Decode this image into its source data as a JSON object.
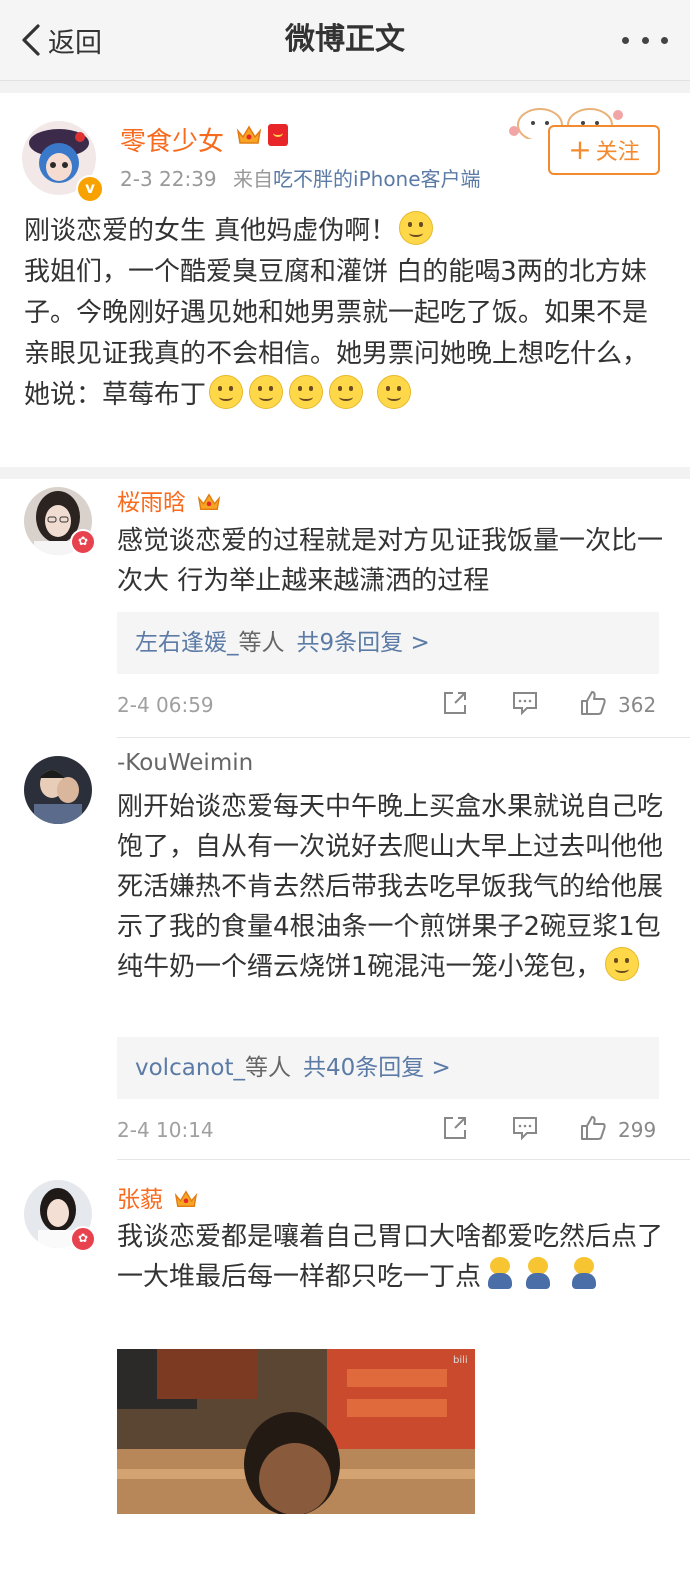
{
  "nav": {
    "back_label": "返回",
    "title": "微博正文"
  },
  "post": {
    "author": "零食少女",
    "time": "2-3 22:39",
    "source_prefix": "来自",
    "source": "吃不胖的iPhone客户端",
    "follow_label": "关注",
    "text_line1": "刚谈恋爱的女生  真他妈虚伪啊！",
    "text_body": "我姐们，一个酷爱臭豆腐和灌饼 白的能喝3两的北方妹子。今晚刚好遇见她和她男票就一起吃了饭。如果不是亲眼见证我真的不会相信。她男票问她晚上想吃什么，她说：草莓布丁"
  },
  "comments": [
    {
      "name": "桜雨晗",
      "text": "感觉谈恋爱的过程就是对方见证我饭量一次比一次大 行为举止越来越潇洒的过程",
      "reply_users": "左右逢媛_",
      "reply_suffix": "等人",
      "reply_count": "共9条回复 >",
      "time": "2-4 06:59",
      "likes": "362"
    },
    {
      "name": "-KouWeimin",
      "text": "刚开始谈恋爱每天中午晚上买盒水果就说自己吃饱了，自从有一次说好去爬山大早上过去叫他他死活嫌热不肯去然后带我去吃早饭我气的给他展示了我的食量4根油条一个煎饼果子2碗豆浆1包纯牛奶一个缙云烧饼1碗混沌一笼小笼包，",
      "reply_users": "volcanot_",
      "reply_suffix": "等人",
      "reply_count": "共40条回复 >",
      "time": "2-4 10:14",
      "likes": "299"
    },
    {
      "name": "张藐",
      "text": "我谈恋爱都是嚷着自己胃口大啥都爱吃然后点了一大堆最后每一样都只吃一丁点"
    }
  ],
  "image_watermark": "bili",
  "colors": {
    "accent_orange": "#f86b1e",
    "link_blue": "#5b7ba6",
    "follow_orange": "#f38a2e"
  },
  "icons": [
    "back-chevron-icon",
    "more-icon",
    "crown-icon",
    "red-packet-icon",
    "share-icon",
    "comment-icon",
    "like-icon",
    "smile-emoji-icon",
    "doge-emoji-icon"
  ]
}
